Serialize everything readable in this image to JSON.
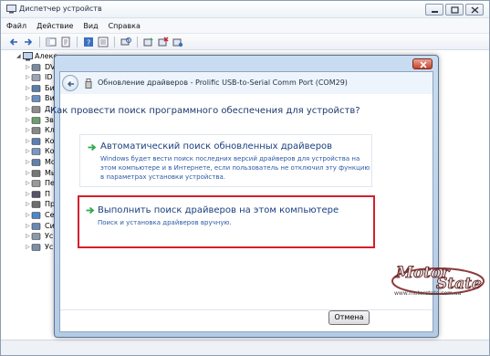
{
  "window": {
    "title": "Диспетчер устройств",
    "menu": [
      "Файл",
      "Действие",
      "Вид",
      "Справка"
    ]
  },
  "tree": {
    "root": "Алекс",
    "items": [
      {
        "label": "DV",
        "icon": "dvd-icon"
      },
      {
        "label": "ID",
        "icon": "ide-icon"
      },
      {
        "label": "Би",
        "icon": "biometric-icon"
      },
      {
        "label": "Ви",
        "icon": "video-icon"
      },
      {
        "label": "Ди",
        "icon": "disk-icon"
      },
      {
        "label": "Зв",
        "icon": "sound-icon"
      },
      {
        "label": "Кл",
        "icon": "keyboard-icon"
      },
      {
        "label": "Ко",
        "icon": "computer-icon"
      },
      {
        "label": "Ко",
        "icon": "controller-icon"
      },
      {
        "label": "Мо",
        "icon": "monitor-icon"
      },
      {
        "label": "Мы",
        "icon": "mouse-icon"
      },
      {
        "label": "Пе",
        "icon": "portable-icon"
      },
      {
        "label": "П",
        "icon": "port-icon"
      },
      {
        "label": "Пр",
        "icon": "processor-icon"
      },
      {
        "label": "Се",
        "icon": "network-icon"
      },
      {
        "label": "Си",
        "icon": "system-icon"
      },
      {
        "label": "Ус",
        "icon": "hid-icon"
      },
      {
        "label": "Ус",
        "icon": "usb-icon"
      }
    ]
  },
  "dialog": {
    "title": "Обновление драйверов - Prolific USB-to-Serial Comm Port (COM29)",
    "question": "Как провести поиск программного обеспечения для устройств?",
    "options": [
      {
        "title": "Автоматический поиск обновленных драйверов",
        "desc": "Windows будет вести поиск последних версий драйверов для устройства на этом компьютере и в Интернете, если пользователь не отключил эту функцию в параметрах установки устройства."
      },
      {
        "title": "Выполнить поиск драйверов на этом компьютере",
        "desc": "Поиск и установка драйверов вручную."
      }
    ],
    "cancel": "Отмена"
  },
  "watermark": {
    "text": "Motor State",
    "url": "www.motorstate.com.ua"
  },
  "colors": {
    "highlight": "#d3202a",
    "link": "#193f7f",
    "arrow": "#2fa84f"
  }
}
